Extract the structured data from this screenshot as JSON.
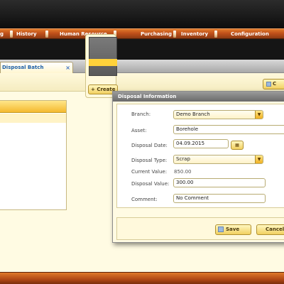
{
  "menu": {
    "items": [
      {
        "label": "g"
      },
      {
        "label": "History"
      },
      {
        "label": "Human Resource"
      },
      {
        "label": "Purchasing"
      },
      {
        "label": "Inventory"
      },
      {
        "label": "Configuration"
      }
    ]
  },
  "tabs": {
    "active_label": "Disposal Batch Information",
    "close_glyph": "×"
  },
  "toolbar": {
    "top_button_label": "C"
  },
  "midpanel": {
    "create_button_label": "Create"
  },
  "dialog": {
    "title": "Disposal Information",
    "fields": {
      "branch": {
        "label": "Branch:",
        "value": "Demo Branch"
      },
      "asset": {
        "label": "Asset:",
        "value": "Borehole"
      },
      "disposal_date": {
        "label": "Disposal Date:",
        "value": "04.09.2015"
      },
      "disposal_type": {
        "label": "Disposal Type:",
        "value": "Scrap"
      },
      "current_value": {
        "label": "Current Value:",
        "value": "850.00"
      },
      "disposal_value": {
        "label": "Disposal Value:",
        "value": "300.00"
      },
      "comment": {
        "label": "Comment:",
        "value": "No Comment"
      }
    },
    "buttons": {
      "save_label": "Save",
      "cancel_label": "Cancel"
    }
  },
  "icons": {
    "dropdown": "chevron-down-icon",
    "calendar": "calendar-icon",
    "save": "save-icon",
    "cancel": "cancel-icon"
  },
  "colors": {
    "menubar": "#c0501a",
    "accent_yellow": "#f4b92e",
    "panel_bg": "#fffbe3",
    "tab_text": "#1d5fa8"
  }
}
